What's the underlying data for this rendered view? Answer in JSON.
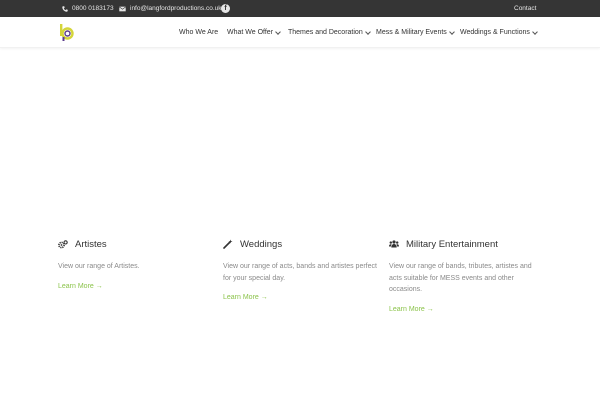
{
  "topbar": {
    "phone": "0800 0183173",
    "email": "info@langfordproductions.co.uk",
    "facebook_glyph": "f",
    "contact_label": "Contact"
  },
  "header": {
    "logo_icon": "lp-logo-icon",
    "nav": [
      {
        "label": "Who We Are",
        "dropdown": false
      },
      {
        "label": "What We Offer",
        "dropdown": true
      },
      {
        "label": "Themes and Decoration",
        "dropdown": true
      },
      {
        "label": "Mess & Military Events",
        "dropdown": true
      },
      {
        "label": "Weddings & Functions",
        "dropdown": true
      }
    ]
  },
  "features": [
    {
      "icon": "gears-icon",
      "title": "Artistes",
      "description": "View our range of Artistes.",
      "link": "Learn More →"
    },
    {
      "icon": "magic-wand-icon",
      "title": "Weddings",
      "description": "View our range of acts, bands and artistes perfect for your special day.",
      "link": "Learn More →"
    },
    {
      "icon": "users-icon",
      "title": "Military Entertainment",
      "description": "View our range of bands, tributes, artistes and acts suitable for MESS events and other occasions.",
      "link": "Learn More →"
    }
  ],
  "colors": {
    "topbar_bg": "#353535",
    "accent_green": "#8bc34a",
    "logo_yellow": "#d4d53a",
    "logo_purple": "#5b3b8c"
  }
}
